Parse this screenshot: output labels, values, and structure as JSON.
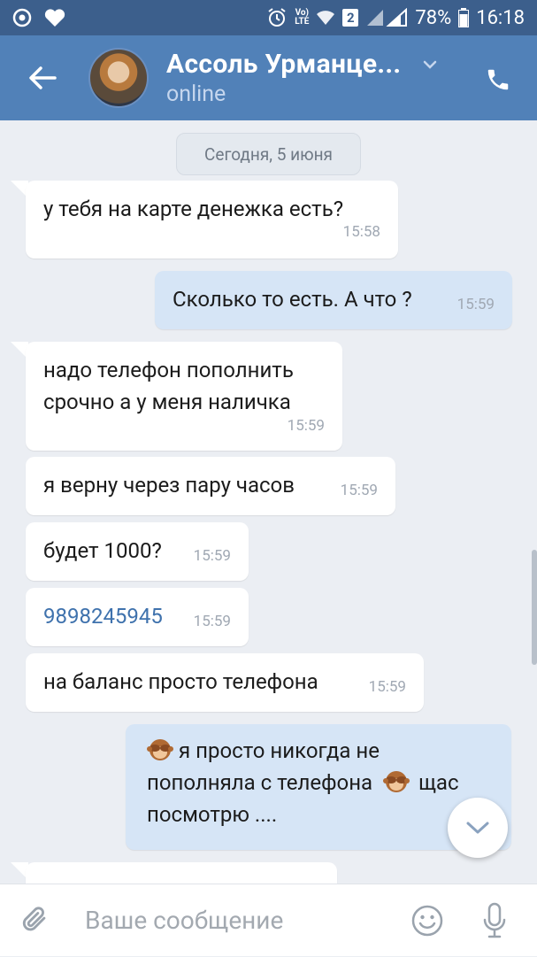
{
  "status_bar": {
    "battery": "78%",
    "time": "16:18",
    "volte": "Vo)\nLTE",
    "sim_badge": "2"
  },
  "header": {
    "contact_name": "Ассоль Урманце...",
    "status": "online"
  },
  "chat": {
    "date": "Сегодня, 5 июня",
    "messages": [
      {
        "dir": "in",
        "text": "у тебя на карте денежка есть?",
        "time": "15:58"
      },
      {
        "dir": "out",
        "text": "Сколько то есть. А что ?",
        "time": "15:59"
      },
      {
        "dir": "in",
        "lines": [
          "надо телефон пополнить",
          "срочно а у меня наличка"
        ],
        "time": "15:59"
      },
      {
        "dir": "in",
        "text": "я верну через пару часов",
        "time": "15:59"
      },
      {
        "dir": "in",
        "text": "будет 1000?",
        "time": "15:59"
      },
      {
        "dir": "in",
        "text": "9898245945",
        "time": "15:59"
      },
      {
        "dir": "in",
        "text": "на баланс просто телефона",
        "time": "15:59"
      },
      {
        "dir": "out",
        "lines": [
          "я просто никогда не",
          "пополняла с телефона",
          "щас",
          "посмотрю ...."
        ]
      }
    ]
  },
  "composer": {
    "placeholder": "Ваше сообщение"
  },
  "icons": {
    "back": "arrow-left-icon",
    "call": "phone-icon",
    "attach": "paperclip-icon",
    "emoji": "smiley-icon",
    "mic": "microphone-icon",
    "scroll": "chevron-down-icon",
    "see_no_evil": "see-no-evil-monkey-emoji"
  },
  "colors": {
    "header": "#5181b8",
    "status_bar": "#3c5f8c",
    "incoming_bubble": "#ffffff",
    "outgoing_bubble": "#d6e5f6",
    "chat_bg": "#ebeef3",
    "link": "#3f72ad"
  }
}
